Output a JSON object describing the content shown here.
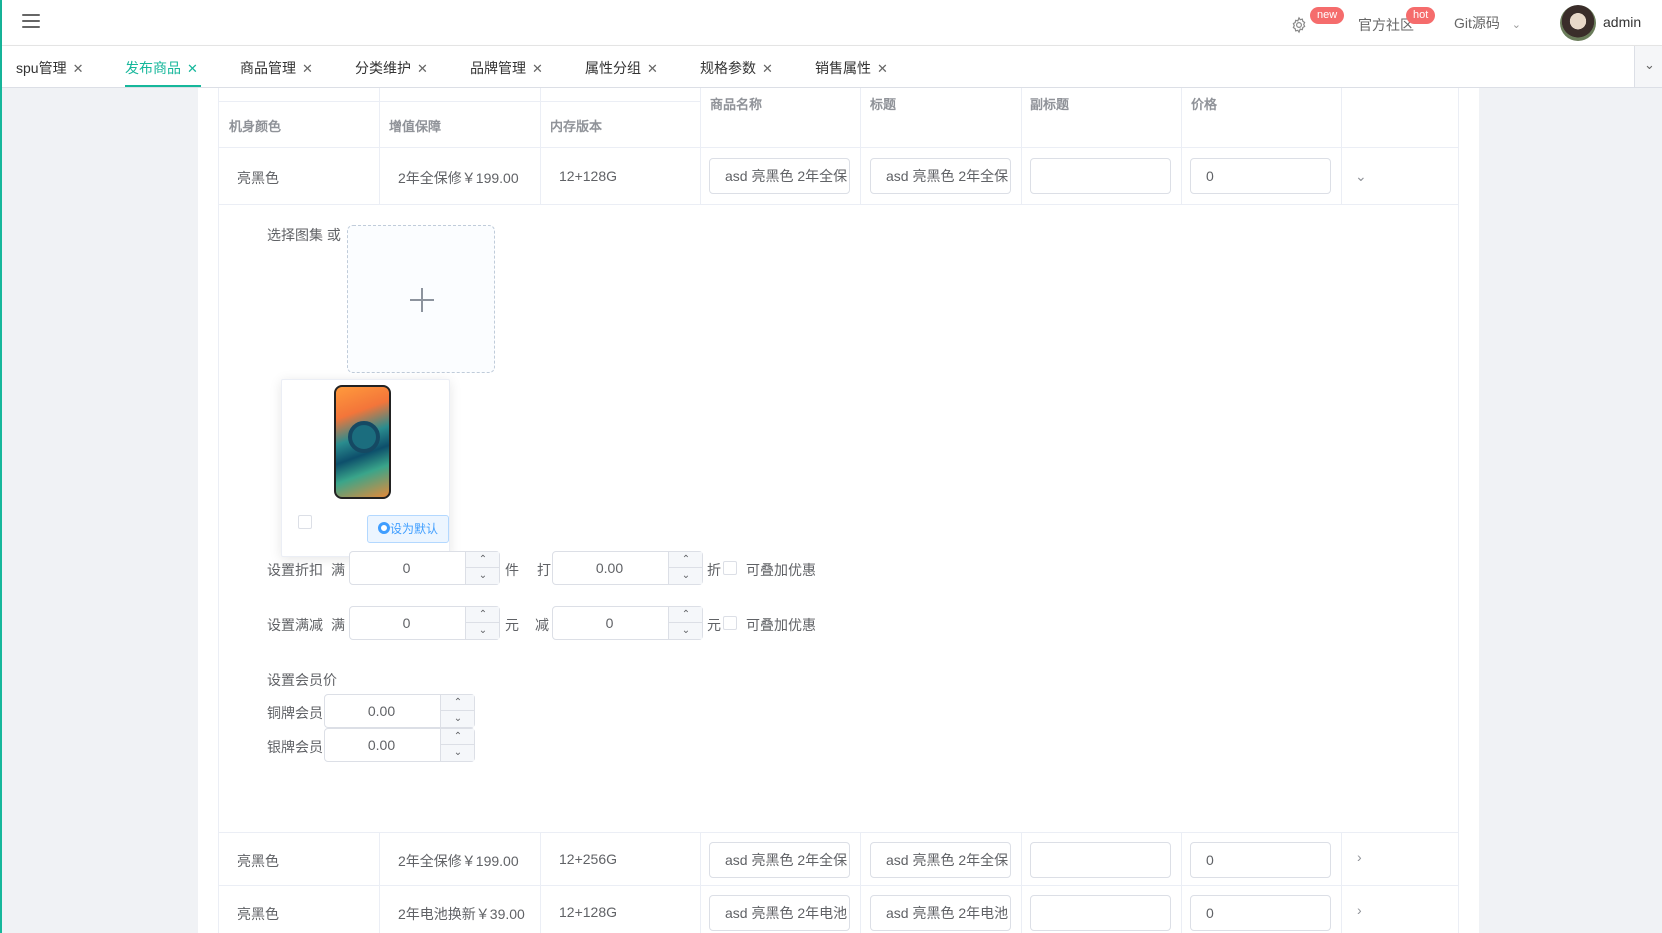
{
  "navbar": {
    "settings_badge": "new",
    "community_label": "官方社区",
    "community_badge": "hot",
    "git_label": "Git源码",
    "username": "admin"
  },
  "tabs": [
    {
      "label": "spu管理",
      "active": false
    },
    {
      "label": "发布商品",
      "active": true
    },
    {
      "label": "商品管理",
      "active": false
    },
    {
      "label": "分类维护",
      "active": false
    },
    {
      "label": "品牌管理",
      "active": false
    },
    {
      "label": "属性分组",
      "active": false
    },
    {
      "label": "规格参数",
      "active": false
    },
    {
      "label": "销售属性",
      "active": false
    }
  ],
  "table": {
    "headers": {
      "color": "机身颜色",
      "warranty": "增值保障",
      "storage": "内存版本",
      "name": "商品名称",
      "title": "标题",
      "subtitle": "副标题",
      "price": "价格"
    },
    "rows": [
      {
        "color": "亮黑色",
        "warranty": "2年全保修￥199.00",
        "storage": "12+128G",
        "name": "asd 亮黑色 2年全保",
        "title": "asd 亮黑色 2年全保",
        "subtitle": "",
        "price": "0",
        "expanded": true
      },
      {
        "color": "亮黑色",
        "warranty": "2年全保修￥199.00",
        "storage": "12+256G",
        "name": "asd 亮黑色 2年全保",
        "title": "asd 亮黑色 2年全保",
        "subtitle": "",
        "price": "0",
        "expanded": false
      },
      {
        "color": "亮黑色",
        "warranty": "2年电池换新￥39.00",
        "storage": "12+128G",
        "name": "asd 亮黑色 2年电池",
        "title": "asd 亮黑色 2年电池",
        "subtitle": "",
        "price": "0",
        "expanded": false
      }
    ]
  },
  "expand": {
    "select_images_label": "选择图集 或",
    "set_default_label": "设为默认",
    "discount": {
      "label": "设置折扣",
      "full_label": "满",
      "full_value": "0",
      "unit": "件",
      "hit_label": "打",
      "rate_value": "0.00",
      "rate_unit": "折",
      "stack_label": "可叠加优惠"
    },
    "reduction": {
      "label": "设置满减",
      "full_label": "满",
      "full_value": "0",
      "unit": "元",
      "minus_label": "减",
      "minus_value": "0",
      "minus_unit": "元",
      "stack_label": "可叠加优惠"
    },
    "member": {
      "label": "设置会员价",
      "bronze_label": "铜牌会员",
      "bronze_value": "0.00",
      "silver_label": "银牌会员",
      "silver_value": "0.00"
    }
  }
}
